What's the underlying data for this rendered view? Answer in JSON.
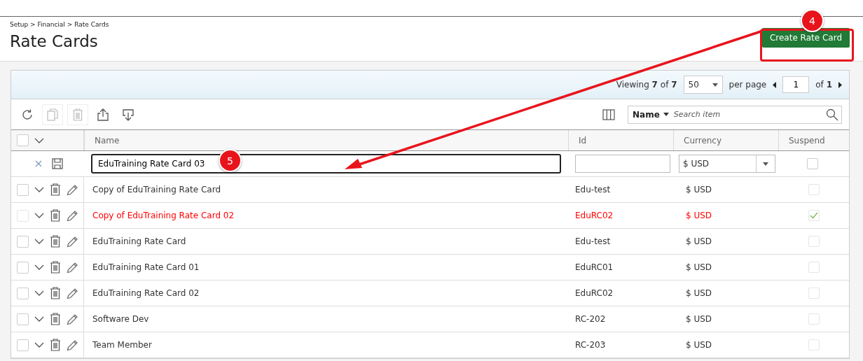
{
  "breadcrumb": "Setup > Financial > Rate Cards",
  "title": "Rate Cards",
  "create_button": "Create Rate Card",
  "pager": {
    "summary": "Viewing **7** of **7**",
    "per_page": "50",
    "per_page_label": "per page",
    "page": "1",
    "page_total": "of **1**"
  },
  "toolbar": [
    {
      "kind": "refresh",
      "disabled": false
    },
    {
      "kind": "copy",
      "disabled": true
    },
    {
      "kind": "delete",
      "disabled": true
    },
    {
      "kind": "export",
      "disabled": false
    },
    {
      "kind": "import",
      "disabled": false
    }
  ],
  "search": {
    "field": "Name",
    "placeholder": "Search item"
  },
  "select_all": {
    "checked": false
  },
  "columns": [
    "Name",
    "Id",
    "Currency",
    "Suspend"
  ],
  "new_row": {
    "name": "EduTraining Rate Card 03",
    "currency": "$ USD",
    "suspend": false
  },
  "rows": [
    {
      "name": "Copy of EduTraining Rate Card",
      "id": "Edu-test",
      "currency": "$ USD",
      "suspended": false,
      "checked": false
    },
    {
      "name": "Copy of EduTraining Rate Card 02",
      "id": "EduRC02",
      "currency": "$ USD",
      "suspended": true,
      "checked": false
    },
    {
      "name": "EduTraining Rate Card",
      "id": "Edu-test",
      "currency": "$ USD",
      "suspended": false,
      "checked": false
    },
    {
      "name": "EduTraining Rate Card 01",
      "id": "EduRC01",
      "currency": "$ USD",
      "suspended": false,
      "checked": false
    },
    {
      "name": "EduTraining Rate Card 02",
      "id": "EduRC02",
      "currency": "$ USD",
      "suspended": false,
      "checked": false
    },
    {
      "name": "Software Dev",
      "id": "RC-202",
      "currency": "$ USD",
      "suspended": false,
      "checked": false
    },
    {
      "name": "Team Member",
      "id": "RC-203",
      "currency": "$ USD",
      "suspended": false,
      "checked": false
    }
  ],
  "steps": [
    "4",
    "5"
  ]
}
